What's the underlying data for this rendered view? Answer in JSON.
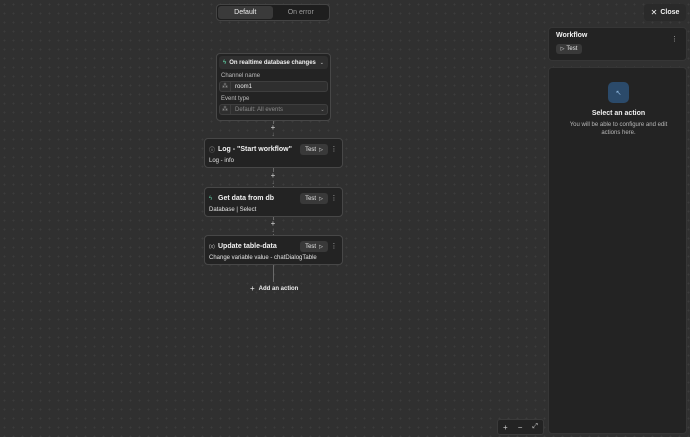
{
  "tabs": [
    {
      "label": "Default",
      "active": true
    },
    {
      "label": "On error",
      "active": false
    }
  ],
  "trigger": {
    "label": "On realtime database changes",
    "channel_label": "Channel name",
    "channel_value": "room1",
    "event_label": "Event type",
    "event_value": "Default: All events"
  },
  "actions": [
    {
      "title": "Log - \"Start workflow\"",
      "subtitle": "Log - info",
      "icon": "info-icon",
      "test_label": "Test"
    },
    {
      "title": "Get data from db",
      "subtitle": "Database | Select",
      "icon": "bolt-icon",
      "test_label": "Test"
    },
    {
      "title": "Update table-data",
      "subtitle": "Change variable value - chatDialogTable",
      "icon": "variable-icon",
      "test_label": "Test"
    }
  ],
  "add_action_label": "Add an action",
  "close_label": "Close",
  "workflow_panel": {
    "title": "Workflow",
    "test_label": "Test"
  },
  "select_panel": {
    "title": "Select an action",
    "description": "You will be able to configure and edit actions here."
  },
  "colors": {
    "accent_icon_bg": "#2b4a6a",
    "canvas": "#303030",
    "card": "#232323"
  }
}
